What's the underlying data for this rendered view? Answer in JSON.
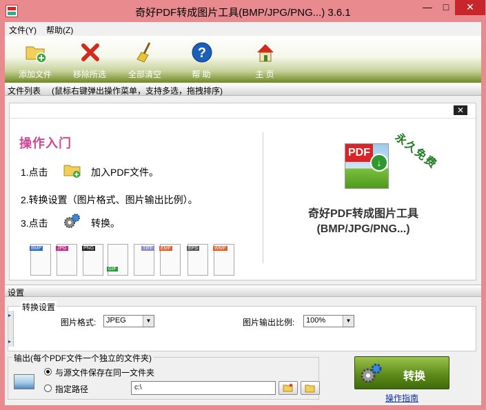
{
  "window": {
    "title": "奇好PDF转成图片工具(BMP/JPG/PNG...) 3.6.1",
    "min_glyph": "—",
    "max_glyph": "□",
    "close_glyph": "✕"
  },
  "menu": {
    "file": "文件(Y)",
    "help": "帮助(Z)"
  },
  "toolbar": {
    "add": "添加文件",
    "remove": "移除所选",
    "clear": "全部清空",
    "help": "帮 助",
    "home": "主 页"
  },
  "filelist": {
    "label": "文件列表",
    "hint": "(鼠标右键弹出操作菜单，支持多选，拖拽排序)"
  },
  "guide": {
    "close_glyph": "✕",
    "title": "操作入门",
    "step1_prefix": "1.点击",
    "step1_suffix": "加入PDF文件。",
    "step2": "2.转换设置（图片格式、图片输出比例）。",
    "step3_prefix": "3.点击",
    "step3_suffix": "转换。",
    "formats": [
      "BMP",
      "JPG",
      "PNG",
      "GIF",
      "TIFF",
      "EMF",
      "EPS",
      "WMF"
    ],
    "pdf_tag": "PDF",
    "free_badge": "永久免费",
    "product_line1": "奇好PDF转成图片工具",
    "product_line2": "(BMP/JPG/PNG...)"
  },
  "settings": {
    "label": "设置",
    "group": "转换设置",
    "format_label": "图片格式:",
    "format_value": "JPEG",
    "ratio_label": "图片输出比例:",
    "ratio_value": "100%"
  },
  "output": {
    "group": "输出(每个PDF文件一个独立的文件夹)",
    "opt_same": "与源文件保存在同一文件夹",
    "opt_custom": "指定路径",
    "path_value": "c:\\"
  },
  "actions": {
    "convert": "转换",
    "guide_link": "操作指南"
  }
}
